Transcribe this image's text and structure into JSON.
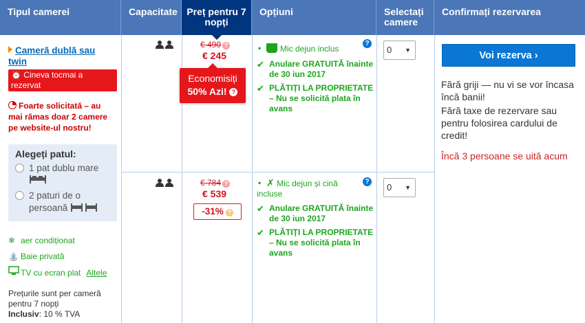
{
  "header": {
    "room_type": "Tipul camerei",
    "capacity": "Capacitate",
    "price": "Preț pentru 7 nopți",
    "options": "Opțiuni",
    "select": "Selectați camere",
    "confirm": "Confirmați rezervarea"
  },
  "room": {
    "name": "Cameră dublă sau twin",
    "alert": "Cineva tocmai a rezervat",
    "demand": "Foarte solicitată – au mai rămas doar 2 camere pe website-ul nostru!",
    "bed_title": "Alegeți patul:",
    "bed_option_1": "1 pat dublu mare",
    "bed_option_2": "2 paturi de o persoană",
    "facilities": [
      "aer condiționat",
      "Baie privată",
      "TV cu ecran plat"
    ],
    "more_link": "Altele",
    "note_line": "Prețurile sunt per cameră pentru 7 nopți",
    "note_included": "Inclusiv",
    "note_tax": ": 10 % TVA"
  },
  "offers": [
    {
      "old_price": "€ 490",
      "new_price": "€ 245",
      "save_line1": "Economisiți",
      "save_pct": "50%",
      "save_today": "Azi!",
      "meal": "Mic dejun inclus",
      "cancel": "Anulare GRATUITĂ înainte de 30 iun 2017",
      "pay": "PLĂTIȚI LA PROPRIETATE – Nu se solicită plata în avans",
      "select_value": "0"
    },
    {
      "old_price": "€ 784",
      "new_price": "€ 539",
      "discount": "-31%",
      "meal": "Mic dejun și cină incluse",
      "cancel": "Anulare GRATUITĂ înainte de 30 iun 2017",
      "pay": "PLĂTIȚI LA PROPRIETATE – Nu se solicită plata în avans",
      "select_value": "0"
    }
  ],
  "confirm": {
    "button": "Voi rezerva",
    "line1": "Fără griji — nu vi se vor încasa încă banii!",
    "line2": "Fără taxe de rezervare sau pentru folosirea cardului de credit!",
    "watching": "Încă 3 persoane se uită acum"
  },
  "colors": {
    "header_bg": "#4b76b8",
    "price_header_bg": "#003580",
    "accent_red": "#e5171b",
    "green": "#1ea51e",
    "button_blue": "#0a77d5"
  },
  "icons": [
    "person-icon",
    "alarm-clock-icon",
    "pie-icon",
    "double-bed-icon",
    "twin-bed-icon",
    "snowflake-icon",
    "shower-icon",
    "tv-icon",
    "cup-icon",
    "fork-knife-icon",
    "checkmark-icon",
    "help-icon",
    "chevron-right-icon"
  ]
}
